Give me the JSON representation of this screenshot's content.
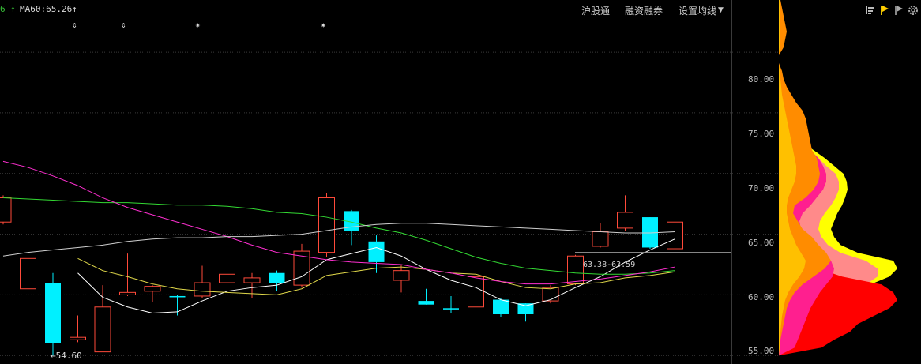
{
  "header": {
    "ma_period_label": "6",
    "ma_period_color": "#38c338",
    "ma60_label": "MA60:65.26",
    "menu": [
      {
        "label": "沪股通"
      },
      {
        "label": "融资融券"
      },
      {
        "label": "设置均线"
      }
    ]
  },
  "markers": [
    "⇕",
    "⇕",
    "✷",
    "✷"
  ],
  "low_label": "←54.60",
  "range_label": "63.38-63.59",
  "y_axis": {
    "ticks": [
      "80.00",
      "75.00",
      "70.00",
      "65.00",
      "60.00",
      "55.00"
    ],
    "tick_values": [
      80,
      75,
      70,
      65,
      60,
      55
    ]
  },
  "toolbar_icons": [
    "bars-icon",
    "flag-yellow-icon",
    "flag-gray-icon",
    "gear-icon"
  ],
  "chart_data": {
    "type": "candlestick",
    "ylim": [
      54.3,
      84.3
    ],
    "candles": [
      {
        "o": 66.0,
        "c": 68.0,
        "h": 68.2,
        "l": 65.8
      },
      {
        "o": 60.5,
        "c": 63.0,
        "h": 63.3,
        "l": 60.2
      },
      {
        "o": 61.0,
        "c": 56.0,
        "h": 61.8,
        "l": 55.0
      },
      {
        "o": 56.3,
        "c": 56.5,
        "h": 58.3,
        "l": 56.1
      },
      {
        "o": 55.3,
        "c": 59.0,
        "h": 60.8,
        "l": 55.3
      },
      {
        "o": 60.0,
        "c": 60.2,
        "h": 63.4,
        "l": 59.9
      },
      {
        "o": 60.3,
        "c": 60.7,
        "h": 60.8,
        "l": 59.4
      },
      {
        "o": 59.9,
        "c": 59.8,
        "h": 60.0,
        "l": 58.3
      },
      {
        "o": 59.9,
        "c": 61.0,
        "h": 62.4,
        "l": 59.7
      },
      {
        "o": 61.0,
        "c": 61.7,
        "h": 62.3,
        "l": 60.8
      },
      {
        "o": 61.0,
        "c": 61.4,
        "h": 61.8,
        "l": 59.7
      },
      {
        "o": 61.8,
        "c": 61.0,
        "h": 62.0,
        "l": 60.3
      },
      {
        "o": 60.8,
        "c": 63.6,
        "h": 64.2,
        "l": 60.6
      },
      {
        "o": 63.5,
        "c": 68.0,
        "h": 68.4,
        "l": 63.1
      },
      {
        "o": 66.9,
        "c": 65.3,
        "h": 67.0,
        "l": 64.1
      },
      {
        "o": 64.4,
        "c": 62.7,
        "h": 64.9,
        "l": 61.8
      },
      {
        "o": 61.2,
        "c": 62.0,
        "h": 62.5,
        "l": 60.2
      },
      {
        "o": 59.5,
        "c": 59.2,
        "h": 60.5,
        "l": 59.2
      },
      {
        "o": 58.9,
        "c": 58.8,
        "h": 59.9,
        "l": 58.5
      },
      {
        "o": 59.0,
        "c": 61.5,
        "h": 61.5,
        "l": 58.8
      },
      {
        "o": 59.6,
        "c": 58.4,
        "h": 59.7,
        "l": 58.2
      },
      {
        "o": 59.3,
        "c": 58.4,
        "h": 59.3,
        "l": 57.8
      },
      {
        "o": 59.5,
        "c": 60.6,
        "h": 60.8,
        "l": 59.3
      },
      {
        "o": 60.9,
        "c": 63.2,
        "h": 63.3,
        "l": 60.8
      },
      {
        "o": 64.0,
        "c": 65.2,
        "h": 65.9,
        "l": 63.9
      },
      {
        "o": 65.5,
        "c": 66.8,
        "h": 68.2,
        "l": 65.3
      },
      {
        "o": 66.4,
        "c": 63.9,
        "h": 66.4,
        "l": 63.8
      },
      {
        "o": 63.8,
        "c": 66.0,
        "h": 66.2,
        "l": 63.7
      }
    ],
    "ma_series": [
      {
        "color": "#ffffff",
        "values": [
          null,
          null,
          null,
          61.8,
          59.8,
          59.0,
          58.5,
          58.6,
          59.5,
          60.3,
          60.6,
          60.8,
          61.5,
          62.9,
          63.4,
          63.9,
          63.2,
          62.1,
          61.2,
          60.6,
          59.6,
          59.1,
          59.6,
          60.6,
          61.5,
          62.7,
          63.7,
          64.6
        ]
      },
      {
        "color": "#e0d84a",
        "values": [
          null,
          null,
          null,
          63.0,
          62.0,
          61.5,
          60.9,
          60.5,
          60.3,
          60.2,
          60.1,
          60.0,
          60.5,
          61.6,
          61.9,
          62.2,
          62.3,
          62.1,
          61.8,
          61.7,
          61.1,
          60.6,
          60.5,
          60.9,
          61.0,
          61.4,
          61.6,
          61.9
        ]
      },
      {
        "color": "#33d933",
        "values": [
          68.0,
          67.9,
          67.8,
          67.7,
          67.6,
          67.6,
          67.5,
          67.4,
          67.4,
          67.3,
          67.1,
          66.8,
          66.7,
          66.4,
          66.0,
          65.5,
          65.1,
          64.5,
          63.8,
          63.1,
          62.6,
          62.2,
          62.0,
          61.8,
          61.7,
          61.7,
          61.8,
          62.0
        ]
      },
      {
        "color": "#ff2fd1",
        "values": [
          71.0,
          70.5,
          69.8,
          69.0,
          68.0,
          67.2,
          66.6,
          66.0,
          65.4,
          64.8,
          64.1,
          63.5,
          63.2,
          62.9,
          62.7,
          62.6,
          62.5,
          62.1,
          61.8,
          61.4,
          61.1,
          60.9,
          60.9,
          61.1,
          61.3,
          61.6,
          61.9,
          62.3
        ]
      },
      {
        "color": "#cfcfcf",
        "values": [
          63.2,
          63.5,
          63.7,
          63.9,
          64.1,
          64.4,
          64.6,
          64.7,
          64.7,
          64.8,
          64.8,
          64.9,
          65.0,
          65.3,
          65.6,
          65.8,
          65.9,
          65.9,
          65.8,
          65.7,
          65.6,
          65.5,
          65.4,
          65.3,
          65.2,
          65.1,
          65.1,
          65.2
        ]
      }
    ],
    "price_line": 63.5,
    "distribution_layers": [
      {
        "color": "#ffffff",
        "values": [
          0,
          0,
          0,
          0,
          0,
          0,
          0,
          0,
          0,
          0,
          1,
          3,
          4,
          5,
          8,
          12,
          16,
          22,
          30,
          42,
          55,
          70,
          80,
          82,
          82,
          80,
          78,
          74,
          68,
          60,
          50,
          40,
          30,
          20,
          10,
          0,
          0,
          0,
          0,
          0,
          0,
          0,
          0,
          0,
          0,
          0
        ]
      },
      {
        "color": "#ffff00",
        "values": [
          0,
          0,
          0,
          0,
          0,
          0,
          0,
          0,
          0,
          0,
          1,
          2,
          3,
          5,
          8,
          12,
          16,
          22,
          30,
          44,
          58,
          70,
          82,
          86,
          87,
          84,
          80,
          74,
          70,
          66,
          70,
          78,
          100,
          145,
          150,
          140,
          116,
          90,
          70,
          48,
          38,
          24,
          16,
          10,
          6,
          0
        ]
      },
      {
        "color": "#ff8a8a",
        "values": [
          0,
          0,
          0,
          0,
          0,
          0,
          0,
          0,
          0,
          0,
          1,
          2,
          3,
          5,
          8,
          12,
          16,
          22,
          30,
          40,
          50,
          60,
          72,
          76,
          76,
          72,
          66,
          58,
          52,
          50,
          54,
          62,
          78,
          110,
          125,
          125,
          110,
          90,
          72,
          52,
          40,
          28,
          18,
          10,
          6,
          0
        ]
      },
      {
        "color": "#ff0000",
        "values": [
          0,
          0,
          0,
          0,
          0,
          0,
          0,
          0,
          0,
          0,
          0,
          0,
          0,
          0,
          0,
          0,
          0,
          0,
          0,
          0,
          0,
          0,
          0,
          0,
          0,
          0,
          0,
          0,
          0,
          0,
          0,
          0,
          0,
          0,
          50,
          80,
          130,
          145,
          150,
          140,
          120,
          100,
          90,
          70,
          54,
          0
        ]
      },
      {
        "color": "#ff1f8f",
        "values": [
          0,
          0,
          0,
          0,
          0,
          0,
          0,
          0,
          0,
          0,
          1,
          2,
          3,
          5,
          8,
          12,
          16,
          22,
          30,
          40,
          50,
          56,
          60,
          60,
          56,
          48,
          40,
          30,
          26,
          28,
          34,
          44,
          56,
          66,
          70,
          68,
          60,
          52,
          46,
          40,
          36,
          32,
          28,
          24,
          20,
          0
        ]
      },
      {
        "color": "#ff8c00",
        "values": [
          2,
          4,
          6,
          8,
          10,
          8,
          6,
          0,
          0,
          4,
          6,
          10,
          16,
          22,
          30,
          34,
          36,
          38,
          40,
          42,
          48,
          50,
          52,
          50,
          44,
          34,
          20,
          18,
          24,
          30,
          42,
          50,
          60,
          66,
          58,
          44,
          30,
          20,
          14,
          10,
          8,
          6,
          4,
          2,
          1,
          0
        ]
      },
      {
        "color": "#ffc000",
        "values": [
          1,
          2,
          2,
          2,
          2,
          2,
          1,
          0,
          0,
          1,
          2,
          3,
          4,
          6,
          8,
          10,
          12,
          14,
          16,
          18,
          20,
          22,
          22,
          20,
          16,
          12,
          10,
          10,
          12,
          14,
          18,
          22,
          28,
          34,
          32,
          26,
          18,
          12,
          8,
          6,
          4,
          3,
          2,
          1,
          1,
          0
        ]
      }
    ]
  }
}
